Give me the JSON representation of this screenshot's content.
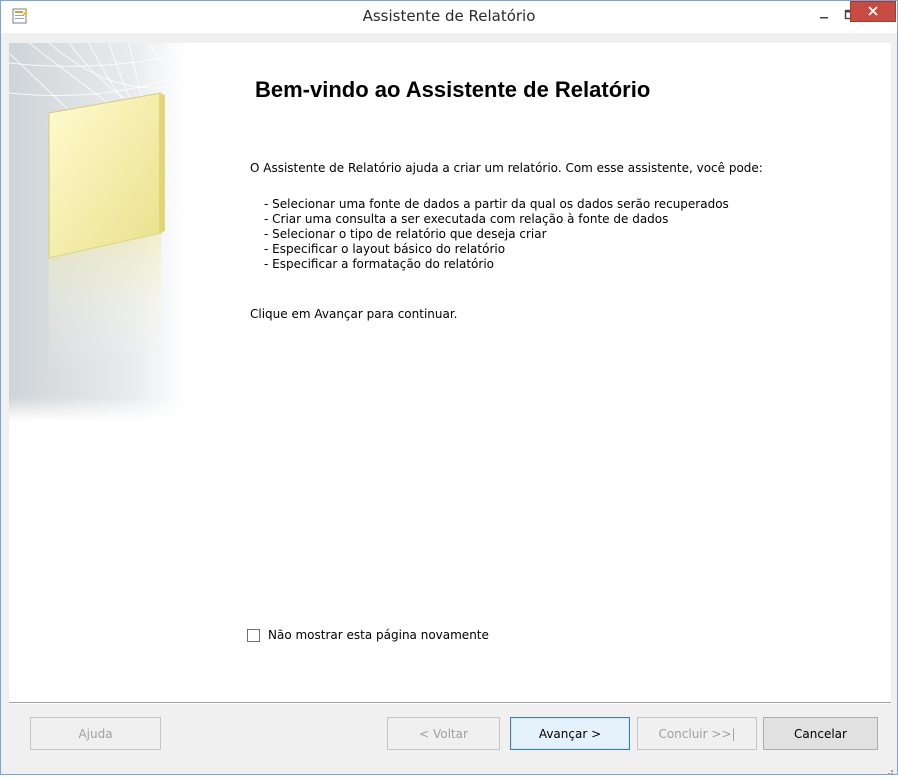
{
  "window": {
    "title": "Assistente de Relatório"
  },
  "titlebar": {
    "icons": {
      "app": "report-wizard-icon",
      "minimize": "minimize-icon",
      "maximize": "maximize-icon",
      "close": "close-icon"
    },
    "close_color": "#c74b41"
  },
  "page": {
    "heading": "Bem-vindo ao Assistente de Relatório",
    "intro": "O Assistente de Relatório ajuda a criar um relatório. Com esse assistente, você pode:",
    "bullets": [
      "- Selecionar uma fonte de dados a partir da qual os dados serão recuperados",
      "- Criar uma consulta a ser executada com relação à fonte de dados",
      "- Selecionar o tipo de relatório que deseja criar",
      "- Especificar o layout básico do relatório",
      "- Especificar a formatação do relatório"
    ],
    "next_hint": "Clique em Avançar para continuar.",
    "dont_show": {
      "label": "Não mostrar esta página novamente",
      "checked": false
    }
  },
  "buttons": {
    "help": {
      "label": "Ajuda",
      "enabled": false
    },
    "back": {
      "label": "< Voltar",
      "enabled": false
    },
    "next": {
      "label": "Avançar >",
      "enabled": true,
      "default": true
    },
    "finish": {
      "label": "Concluir >>|",
      "enabled": false
    },
    "cancel": {
      "label": "Cancelar",
      "enabled": true
    }
  },
  "colors": {
    "default_button_border": "#3c7fb1",
    "window_border": "#7aa6d6"
  }
}
